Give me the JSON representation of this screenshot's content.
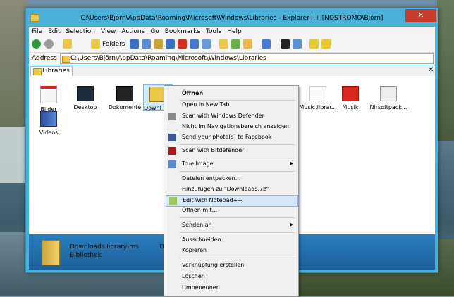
{
  "window": {
    "title": "C:\\Users\\Björn\\AppData\\Roaming\\Microsoft\\Windows\\Libraries - Explorer++ [NOSTROMO\\Björn]",
    "close_label": "✕",
    "minimize_label": "—"
  },
  "menubar": [
    "File",
    "Edit",
    "Selection",
    "View",
    "Actions",
    "Go",
    "Bookmarks",
    "Tools",
    "Help"
  ],
  "toolbar": {
    "folders_label": "Folders"
  },
  "address": {
    "label": "Address",
    "value": "C:\\Users\\Björn\\AppData\\Roaming\\Microsoft\\Windows\\Libraries"
  },
  "tab": {
    "label": "Libraries",
    "close_label": "✕"
  },
  "items": [
    {
      "label": "Bilder"
    },
    {
      "label": "Desktop"
    },
    {
      "label": "Dokumente"
    },
    {
      "label": "Downl"
    },
    {
      "label": "Music.librar..."
    },
    {
      "label": "Musik"
    },
    {
      "label": "Nirsoftpack..."
    },
    {
      "label": "Videos"
    }
  ],
  "details": {
    "name": "Downloads.library-ms",
    "type": "Bibliothek",
    "extra": "Da"
  },
  "context_menu": {
    "open": "Öffnen",
    "open_new_tab": "Open in New Tab",
    "scan_defender": "Scan with Windows Defender",
    "not_in_nav": "Nicht im Navigationsbereich anzeigen",
    "send_facebook": "Send your photo(s) to Facebook",
    "scan_bitdefender": "Scan with Bitdefender",
    "true_image": "True Image",
    "extract": "Dateien entpacken...",
    "add_7z": "Hinzufügen zu \"Downloads.7z\"",
    "edit_notepad": "Edit with Notepad++",
    "open_with": "Öffnen mit...",
    "send_to": "Senden an",
    "cut": "Ausschneiden",
    "copy": "Kopieren",
    "create_shortcut": "Verknüpfung erstellen",
    "delete": "Löschen",
    "rename": "Umbenennen",
    "submenu_arrow": "▶"
  },
  "colors": {
    "window_frame": "#4ab0d8",
    "close_button": "#c73c2e",
    "details_pane": "#1d5f98",
    "highlight": "#d5e7f8"
  }
}
